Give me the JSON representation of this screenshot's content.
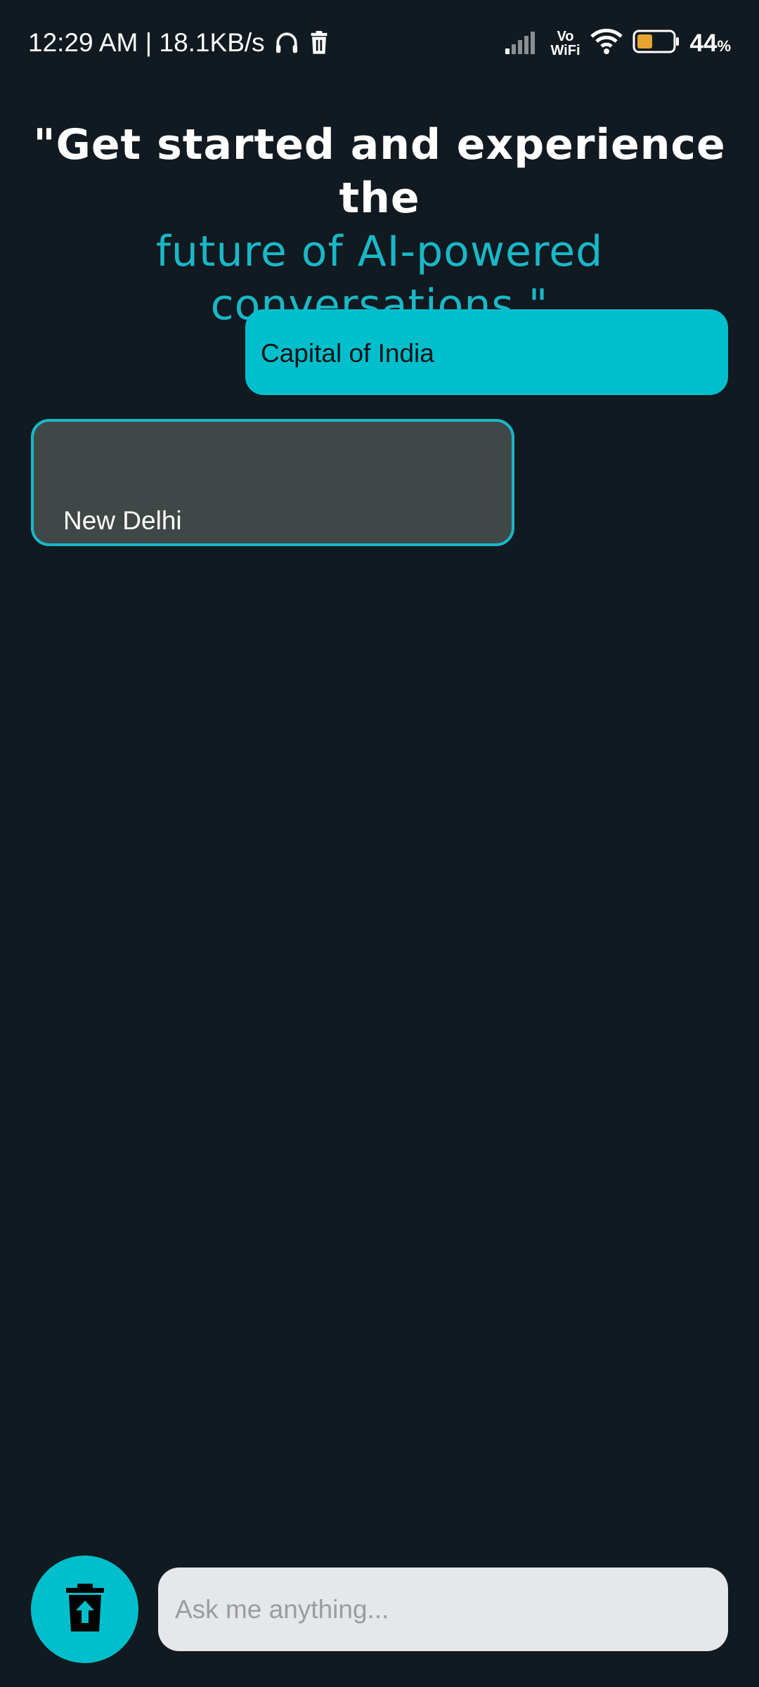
{
  "status_bar": {
    "time_speed": "12:29 AM | 18.1KB/s",
    "vowifi_top": "Vo",
    "vowifi_bottom": "WiFi",
    "battery_percent": "44",
    "battery_percent_sign": "%",
    "battery_level": 0.44,
    "icons": [
      "headphones-icon",
      "trash-icon",
      "signal-icon",
      "wifi-icon",
      "battery-icon"
    ]
  },
  "headline": {
    "line_white": "\"Get started and experience the",
    "line_accent_1": "future of AI-powered",
    "line_accent_2": "conversations.\""
  },
  "chat": {
    "messages": [
      {
        "role": "user",
        "text": "Capital of India"
      },
      {
        "role": "bot",
        "text": "New Delhi"
      }
    ]
  },
  "composer": {
    "placeholder": "Ask me anything...",
    "clear_icon": "delete-upload-icon"
  },
  "colors": {
    "background": "#111a20",
    "accent": "#00bfcc",
    "bot_bubble": "#404847",
    "input_bg": "#e6e7ea",
    "battery_fill": "#e6a532"
  }
}
